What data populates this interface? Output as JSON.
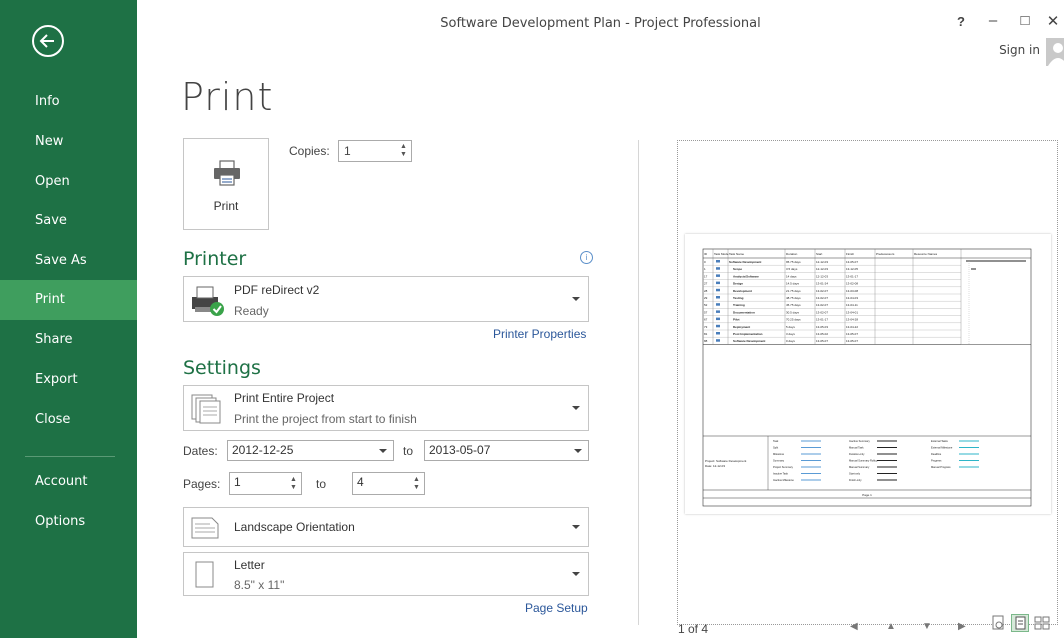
{
  "window": {
    "title": "Software Development Plan - Project Professional",
    "help": "?",
    "minimize": "–",
    "maximize": "□",
    "close": "✕",
    "sign_in": "Sign in"
  },
  "sidebar": {
    "items": [
      {
        "label": "Info"
      },
      {
        "label": "New"
      },
      {
        "label": "Open"
      },
      {
        "label": "Save"
      },
      {
        "label": "Save As"
      },
      {
        "label": "Print",
        "active": true
      },
      {
        "label": "Share"
      },
      {
        "label": "Export"
      },
      {
        "label": "Close"
      },
      {
        "label": "Account"
      },
      {
        "label": "Options"
      }
    ]
  },
  "print": {
    "heading": "Print",
    "button_label": "Print",
    "copies_label": "Copies:",
    "copies_value": "1"
  },
  "printer": {
    "heading": "Printer",
    "name": "PDF reDirect v2",
    "status": "Ready",
    "properties_link": "Printer Properties"
  },
  "settings": {
    "heading": "Settings",
    "range_title": "Print Entire Project",
    "range_desc": "Print the project from start to finish",
    "dates_label": "Dates:",
    "date_from": "2012-12-25",
    "to_label1": "to",
    "date_to": "2013-05-07",
    "pages_label": "Pages:",
    "page_from": "1",
    "to_label2": "to",
    "page_to": "4",
    "orientation": "Landscape Orientation",
    "paper_name": "Letter",
    "paper_size": "8.5\" x 11\"",
    "page_setup_link": "Page Setup"
  },
  "preview": {
    "page_indicator": "1 of 4",
    "table_headers": [
      "ID",
      "Task Mode",
      "Task Name",
      "Duration",
      "Start",
      "Finish",
      "Predecessors",
      "Resource Names"
    ],
    "rows": [
      [
        "0",
        "Software Development",
        "95.75 days",
        "12-12-03",
        "13-05-07"
      ],
      [
        "1",
        "Scope",
        "3.5 days",
        "12-12-03",
        "13-12-05"
      ],
      [
        "17",
        "Analysis/Software",
        "14 days",
        "12-12-03",
        "13-01-17"
      ],
      [
        "27",
        "Design",
        "14.5 days",
        "13-01-24",
        "13-02-08"
      ],
      [
        "28",
        "Development",
        "21.75 days",
        "13-02-07",
        "13-03-08"
      ],
      [
        "29",
        "Testing",
        "48.75 days",
        "13-02-07",
        "13-04-03"
      ],
      [
        "52",
        "Training",
        "45.75 days",
        "13-02-07",
        "13-04-11"
      ],
      [
        "57",
        "Documentation",
        "30.5 days",
        "13-02-07",
        "13-04-01"
      ],
      [
        "67",
        "Pilot",
        "70.25 days",
        "13-01-17",
        "13-04-28"
      ],
      [
        "73",
        "Deployment",
        "5 days",
        "13-05-03",
        "13-04-22"
      ],
      [
        "81",
        "Post Implementation",
        "3 days",
        "13-05-02",
        "13-05-07"
      ],
      [
        "88",
        "Software Development",
        "0 days",
        "13-05-07",
        "13-05-07"
      ]
    ],
    "footer_project": "Project: Software Development",
    "footer_date": "Date: 12-12-03",
    "legend": [
      "Task",
      "Split",
      "Milestone",
      "Summary",
      "Project Summary",
      "Inactive Task",
      "Inactive Milestone",
      "Inactive Summary",
      "Manual Task",
      "Duration-only",
      "Manual Summary Rollup",
      "Manual Summary",
      "Start-only",
      "Finish-only",
      "External Tasks",
      "External Milestone",
      "Deadline",
      "Progress",
      "Manual Progress"
    ],
    "page_label": "Page 1"
  }
}
